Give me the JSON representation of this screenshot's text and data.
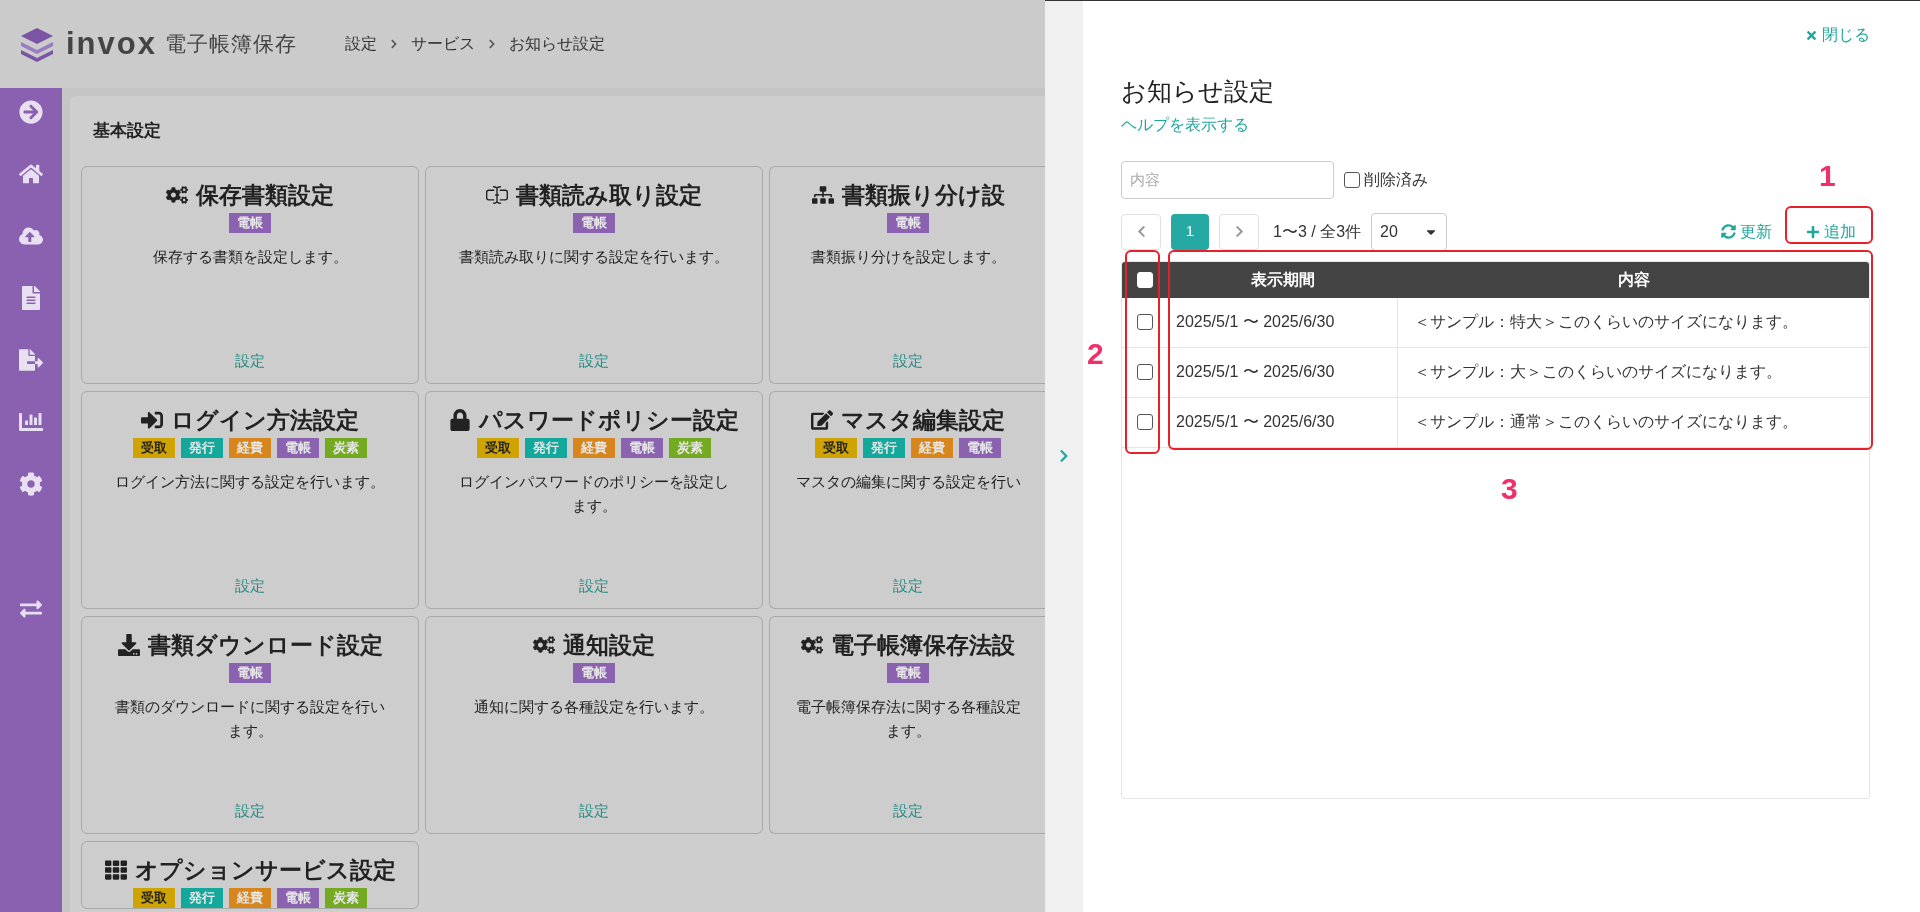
{
  "header": {
    "logo_text": "invox",
    "product": "電子帳簿保存",
    "breadcrumb": [
      "設定",
      "サービス",
      "お知らせ設定"
    ]
  },
  "section_title": "基本設定",
  "cards": [
    {
      "title": "保存書類設定",
      "tags": [
        {
          "label": "電帳",
          "color": "#8b62b0"
        }
      ],
      "description_lines": [
        "保存する書類を設定します。"
      ],
      "link": "設定"
    },
    {
      "title": "書類読み取り設定",
      "tags": [
        {
          "label": "電帳",
          "color": "#8b62b0"
        }
      ],
      "description_lines": [
        "書類読み取りに関する設定を行います。"
      ],
      "link": "設定"
    },
    {
      "title": "書類振り分け設",
      "tags": [
        {
          "label": "電帳",
          "color": "#8b62b0"
        }
      ],
      "description_lines": [
        "書類振り分けを設定します。"
      ],
      "link": "設定"
    },
    {
      "title": "ログイン方法設定",
      "tags": [
        {
          "label": "受取",
          "color": "#cfa400"
        },
        {
          "label": "発行",
          "color": "#14a89c"
        },
        {
          "label": "経費",
          "color": "#d6861c"
        },
        {
          "label": "電帳",
          "color": "#8b62b0"
        },
        {
          "label": "炭素",
          "color": "#74aa22"
        }
      ],
      "description_lines": [
        "ログイン方法に関する設定を行います。"
      ],
      "link": "設定"
    },
    {
      "title": "パスワードポリシー設定",
      "tags": [
        {
          "label": "受取",
          "color": "#cfa400"
        },
        {
          "label": "発行",
          "color": "#14a89c"
        },
        {
          "label": "経費",
          "color": "#d6861c"
        },
        {
          "label": "電帳",
          "color": "#8b62b0"
        },
        {
          "label": "炭素",
          "color": "#74aa22"
        }
      ],
      "description_lines": [
        "ログインパスワードのポリシーを設定し",
        "ます。"
      ],
      "link": "設定"
    },
    {
      "title": "マスタ編集設定",
      "tags": [
        {
          "label": "受取",
          "color": "#cfa400"
        },
        {
          "label": "発行",
          "color": "#14a89c"
        },
        {
          "label": "経費",
          "color": "#d6861c"
        },
        {
          "label": "電帳",
          "color": "#8b62b0"
        }
      ],
      "description_lines": [
        "マスタの編集に関する設定を行い"
      ],
      "link": "設定"
    },
    {
      "title": "書類ダウンロード設定",
      "tags": [
        {
          "label": "電帳",
          "color": "#8b62b0"
        }
      ],
      "description_lines": [
        "書類のダウンロードに関する設定を行い",
        "ます。"
      ],
      "link": "設定"
    },
    {
      "title": "通知設定",
      "tags": [
        {
          "label": "電帳",
          "color": "#8b62b0"
        }
      ],
      "description_lines": [
        "通知に関する各種設定を行います。"
      ],
      "link": "設定"
    },
    {
      "title": "電子帳簿保存法設",
      "tags": [
        {
          "label": "電帳",
          "color": "#8b62b0"
        }
      ],
      "description_lines": [
        "電子帳簿保存法に関する各種設定",
        "ます。"
      ],
      "link": "設定"
    },
    {
      "title": "オプションサービス設定",
      "tags": [
        {
          "label": "受取",
          "color": "#cfa400"
        },
        {
          "label": "発行",
          "color": "#14a89c"
        },
        {
          "label": "経費",
          "color": "#d6861c"
        },
        {
          "label": "電帳",
          "color": "#8b62b0"
        },
        {
          "label": "炭素",
          "color": "#74aa22"
        }
      ]
    }
  ],
  "panel": {
    "close": "閉じる",
    "title": "お知らせ設定",
    "help_link": "ヘルプを表示する",
    "search": {
      "placeholder": "内容"
    },
    "deleted_filter": {
      "label": "削除済み",
      "checked": false
    },
    "pages": [
      {
        "label": "1",
        "selected": true
      }
    ],
    "range": "1〜3 / 全3件",
    "page_size": "20",
    "refresh": "更新",
    "add": "追加",
    "table": {
      "select_all": {
        "checked": false
      },
      "columns": [
        "表示期間",
        "内容"
      ],
      "rows": [
        {
          "checked": false,
          "period": "2025/5/1 〜 2025/6/30",
          "content": "＜サンプル：特大＞このくらいのサイズになります。"
        },
        {
          "checked": false,
          "period": "2025/5/1 〜 2025/6/30",
          "content": "＜サンプル：大＞このくらいのサイズになります。"
        },
        {
          "checked": false,
          "period": "2025/5/1 〜 2025/6/30",
          "content": "＜サンプル：通常＞このくらいのサイズになります。"
        }
      ]
    }
  },
  "annotations": [
    {
      "label": "1"
    },
    {
      "label": "2"
    },
    {
      "label": "3"
    }
  ]
}
